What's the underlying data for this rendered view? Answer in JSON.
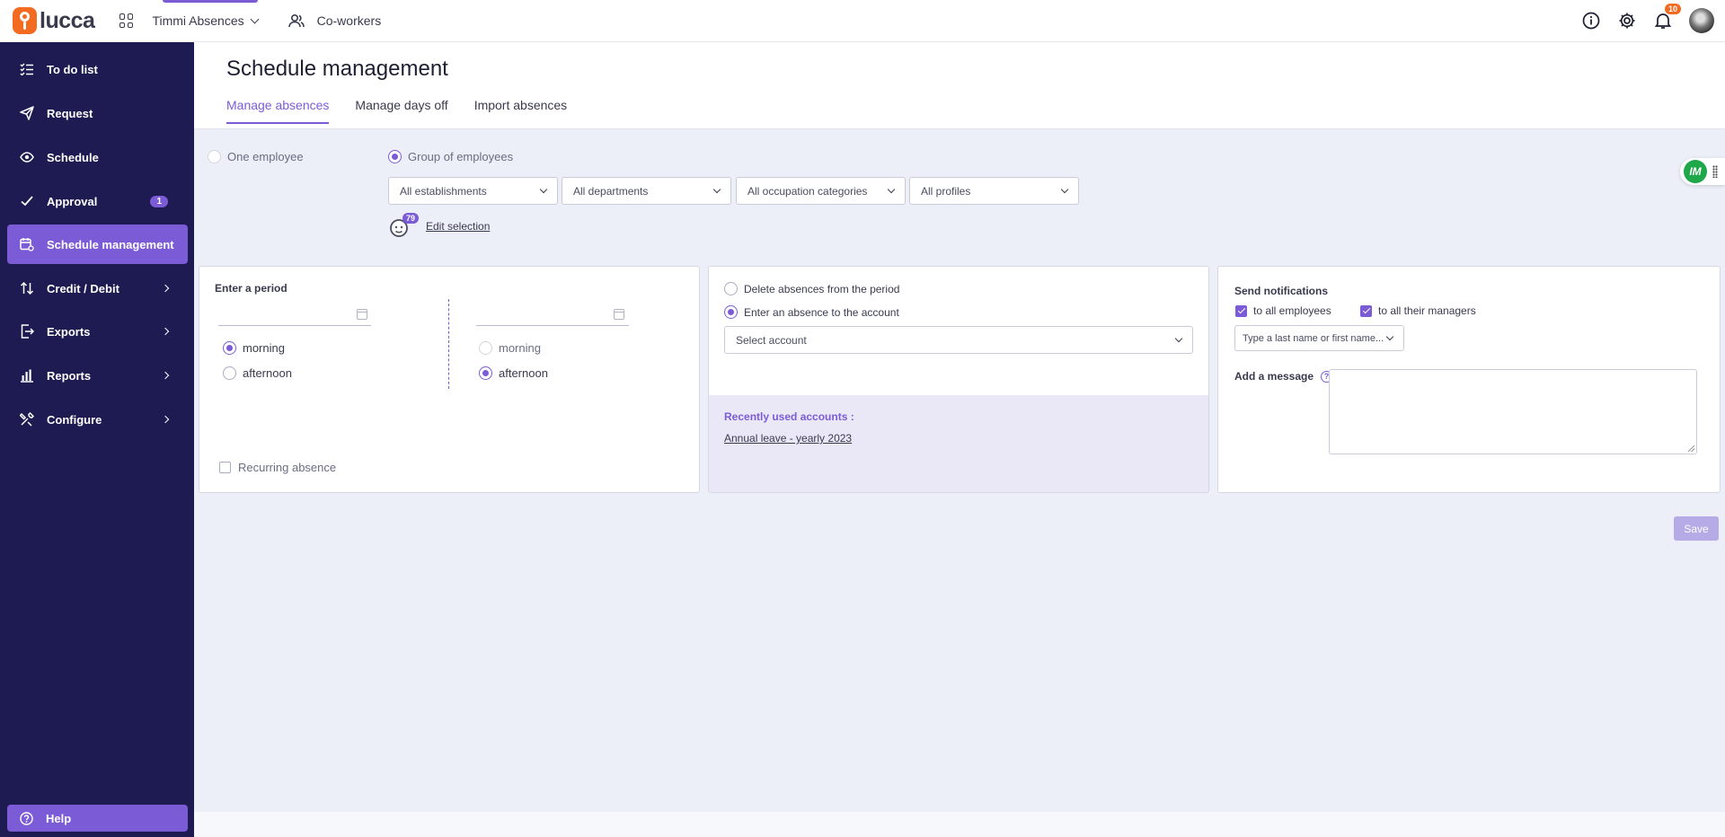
{
  "brand": {
    "name": "lucca",
    "accent": "#7b5bd6",
    "logo_color": "#f26b21",
    "sidebar_bg": "#1d1b51"
  },
  "topbar": {
    "app_name": "Timmi Absences",
    "coworkers": "Co-workers",
    "notifications_count": "10",
    "icons": [
      "info-icon",
      "gear-icon",
      "bell-icon",
      "avatar"
    ]
  },
  "sidebar": {
    "items": [
      {
        "label": "To do list",
        "icon": "checklist-icon"
      },
      {
        "label": "Request",
        "icon": "paper-plane-icon"
      },
      {
        "label": "Schedule",
        "icon": "eye-icon"
      },
      {
        "label": "Approval",
        "icon": "check-icon",
        "badge": "1"
      },
      {
        "label": "Schedule management",
        "icon": "calendar-settings-icon",
        "active": true
      },
      {
        "label": "Credit / Debit",
        "icon": "sort-arrows-icon"
      },
      {
        "label": "Exports",
        "icon": "export-icon"
      },
      {
        "label": "Reports",
        "icon": "bar-chart-icon"
      },
      {
        "label": "Configure",
        "icon": "tools-icon"
      }
    ],
    "help": "Help"
  },
  "header": {
    "title": "Schedule management",
    "tabs": [
      "Manage absences",
      "Manage days off",
      "Import absences"
    ]
  },
  "selection": {
    "one_employee": "One employee",
    "group": "Group of employees",
    "filters": [
      "All establishments",
      "All departments",
      "All occupation categories",
      "All profiles"
    ],
    "employee_count": "79",
    "edit_selection": "Edit selection"
  },
  "period": {
    "title": "Enter a period",
    "start_options": [
      "morning",
      "afternoon"
    ],
    "end_options": [
      "morning",
      "afternoon"
    ],
    "recurring": "Recurring absence"
  },
  "account": {
    "delete_option": "Delete absences from the period",
    "enter_option": "Enter an absence to the account",
    "select_placeholder": "Select account",
    "recent_title": "Recently used accounts :",
    "recent_item": "Annual leave - yearly 2023"
  },
  "notifications": {
    "title": "Send notifications",
    "all_employees": "to all employees",
    "all_managers": "to all their managers",
    "search_placeholder": "Type a last name or first name...",
    "message_label": "Add a message"
  },
  "save": "Save",
  "float_initials": "IM"
}
